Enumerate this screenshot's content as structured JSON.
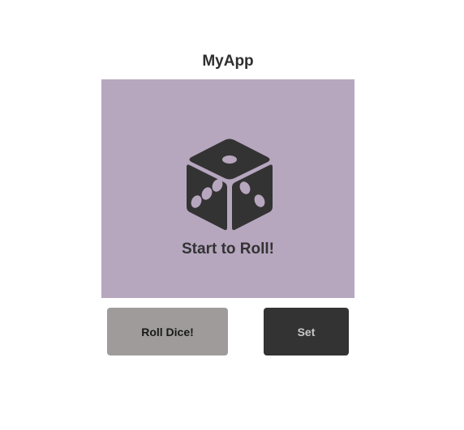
{
  "app": {
    "title": "MyApp"
  },
  "panel": {
    "status_text": "Start to Roll!",
    "background_color": "#b6a7bf",
    "icon": "dice-icon"
  },
  "buttons": {
    "roll_label": "Roll Dice!",
    "roll_color": "#9e9b9a",
    "set_label": "Set",
    "set_color": "#333333"
  }
}
